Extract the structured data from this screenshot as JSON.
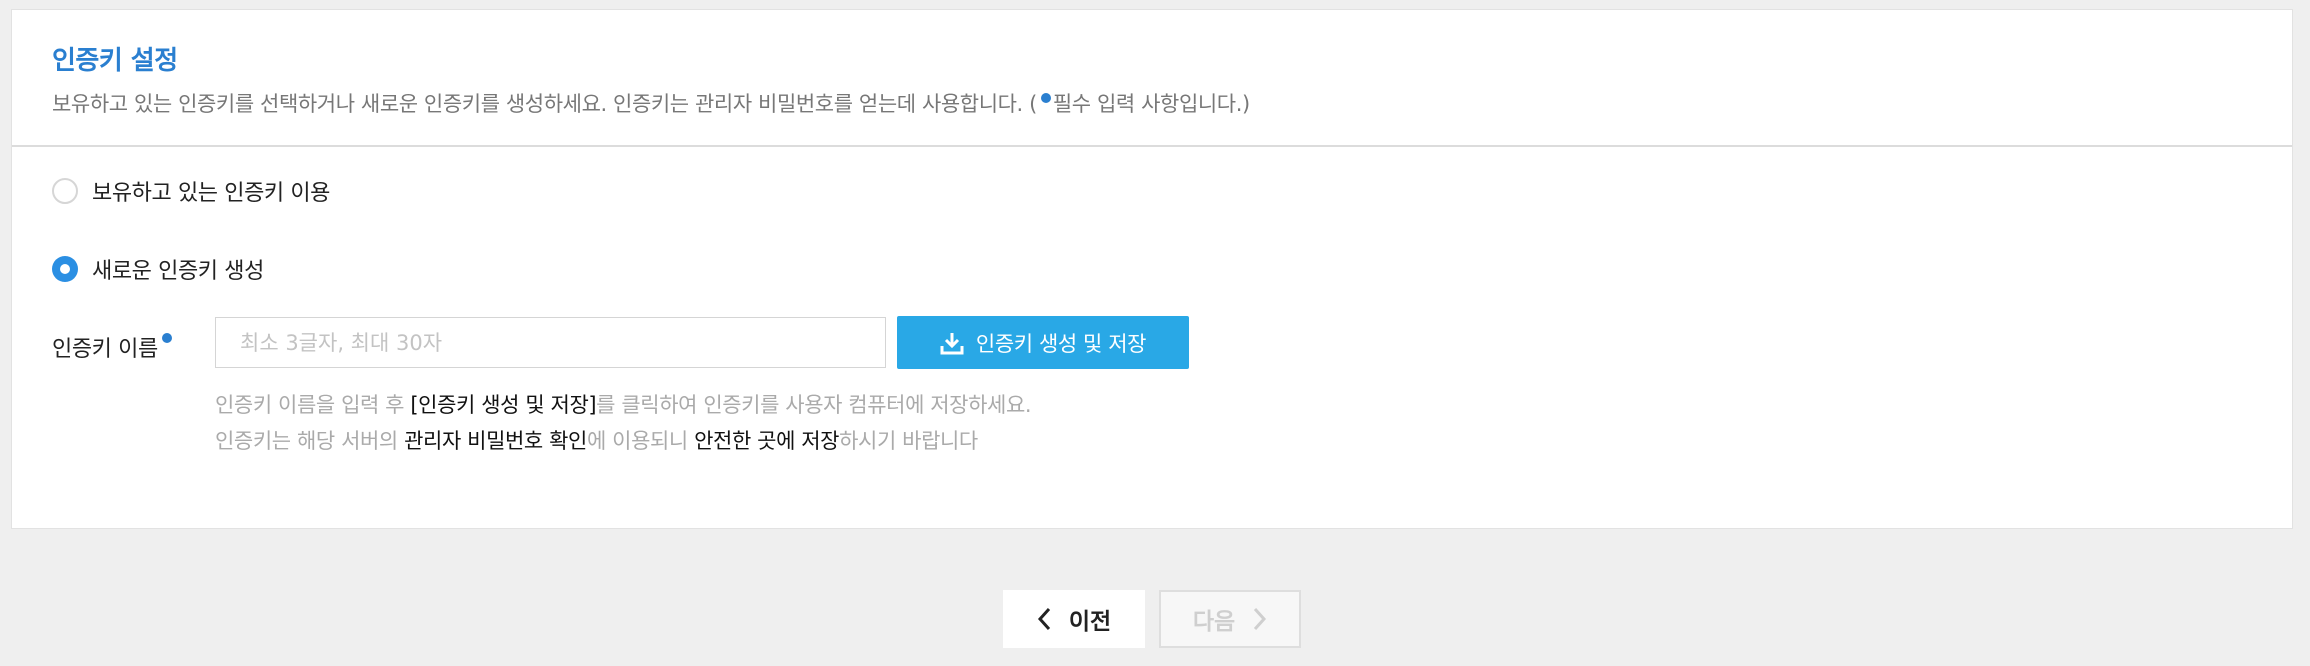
{
  "header": {
    "title": "인증키 설정",
    "subtitle_main": "보유하고 있는 인증키를 선택하거나 새로운 인증키를 생성하세요. 인증키는 관리자 비밀번호를 얻는데 사용합니다. (",
    "subtitle_required": "필수 입력 사항입니다.)"
  },
  "options": {
    "existing_label": "보유하고 있는 인증키 이용",
    "existing_checked": false,
    "new_label": "새로운 인증키 생성",
    "new_checked": true
  },
  "key_name": {
    "label": "인증키 이름",
    "value": "",
    "placeholder": "최소 3글자, 최대 30자"
  },
  "generate_button": {
    "label": "인증키 생성 및 저장",
    "icon": "download-icon"
  },
  "help": {
    "line1_a": "인증키 이름을 입력 후 ",
    "line1_b": "[인증키 생성 및 저장]",
    "line1_c": "를 클릭하여 인증키를 사용자 컴퓨터에 저장하세요.",
    "line2_a": "인증키는 해당 서버의 ",
    "line2_b": "관리자 비밀번호 확인",
    "line2_c": "에 이용되니 ",
    "line2_d": "안전한 곳에 저장",
    "line2_e": "하시기 바랍니다"
  },
  "navigation": {
    "prev_label": "이전",
    "next_label": "다음",
    "next_disabled": true
  },
  "colors": {
    "accent": "#2a7fd0",
    "button": "#29a8e6",
    "radio_checked": "#2b8fe3",
    "background": "#efefef"
  }
}
